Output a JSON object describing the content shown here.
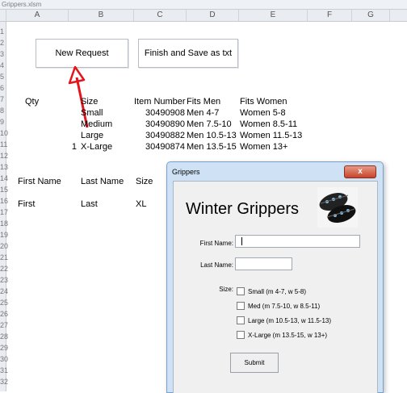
{
  "window": {
    "file_name": "Grippers.xlsm"
  },
  "columns": [
    "A",
    "B",
    "C",
    "D",
    "E",
    "F",
    "G"
  ],
  "rows": [
    "1",
    "2",
    "3",
    "4",
    "5",
    "6",
    "7",
    "8",
    "9",
    "10",
    "11",
    "12",
    "13",
    "14",
    "15",
    "16",
    "17",
    "18",
    "19",
    "20",
    "21",
    "22",
    "23",
    "24",
    "25",
    "26",
    "27",
    "28",
    "29",
    "30",
    "31",
    "32"
  ],
  "sheet_buttons": {
    "new_request": "New Request",
    "finish_save": "Finish and Save as txt"
  },
  "table": {
    "headers": {
      "qty": "Qty",
      "size": "Size",
      "item_number": "Item Number",
      "fits_men": "Fits Men",
      "fits_women": "Fits Women"
    },
    "rows": [
      {
        "qty": "",
        "size": "Small",
        "item": "30490908",
        "men": "Men 4-7",
        "women": "Women 5-8"
      },
      {
        "qty": "",
        "size": "Medium",
        "item": "30490890",
        "men": "Men 7.5-10",
        "women": "Women 8.5-11"
      },
      {
        "qty": "",
        "size": "Large",
        "item": "30490882",
        "men": "Men 10.5-13",
        "women": "Women 11.5-13"
      },
      {
        "qty": "1",
        "size": "X-Large",
        "item": "30490874",
        "men": "Men 13.5-15",
        "women": "Women 13+"
      }
    ]
  },
  "entries": {
    "headers": {
      "first": "First Name",
      "last": "Last Name",
      "size": "Size"
    },
    "row": {
      "first": "First",
      "last": "Last",
      "size": "XL"
    }
  },
  "dialog": {
    "title": "Grippers",
    "close": "x",
    "heading": "Winter Grippers",
    "first_name_label": "First Name:",
    "first_name_value": "",
    "last_name_label": "Last Name:",
    "last_name_value": "",
    "size_label": "Size:",
    "size_options": [
      "Small (m 4-7, w 5-8)",
      "Med (m 7.5-10, w 8.5-11)",
      "Large (m 10.5-13, w 11.5-13)",
      "X-Large (m 13.5-15, w 13+)"
    ],
    "submit": "Submit"
  },
  "colors": {
    "annotation_arrow": "#e4141c",
    "dialog_frame": "#cfe2f5",
    "close_button": "#c7432a"
  }
}
